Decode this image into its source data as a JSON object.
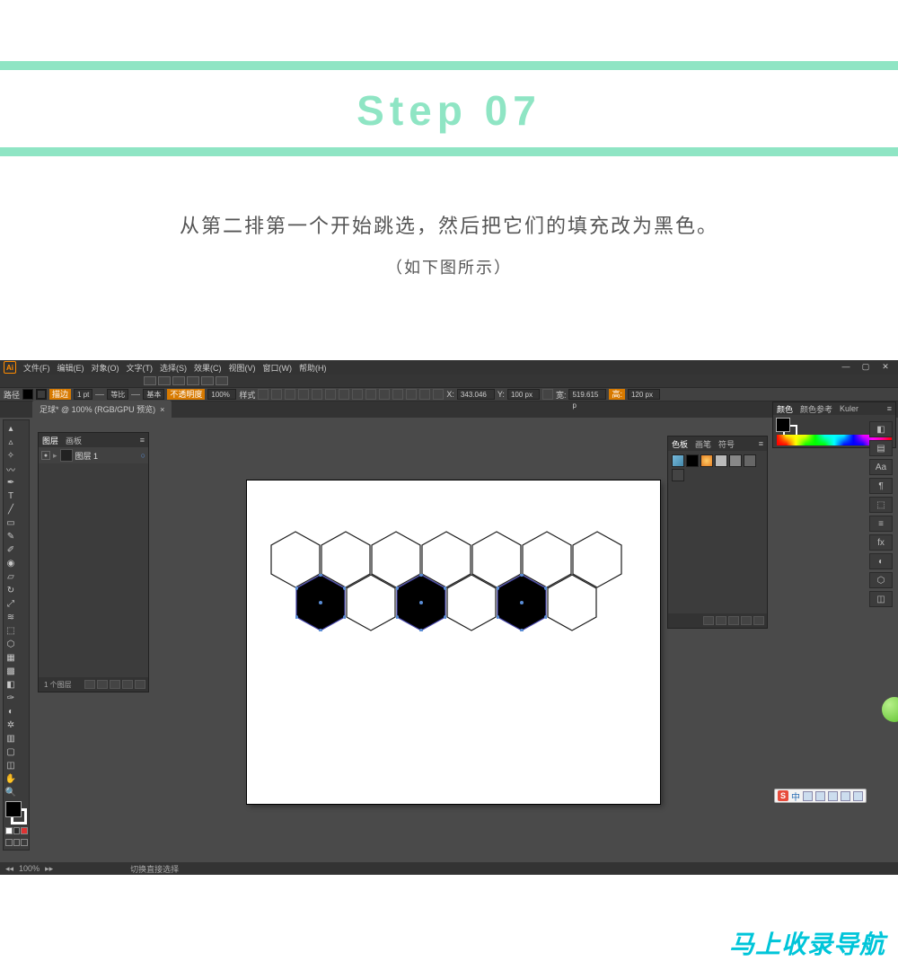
{
  "banner": {
    "step": "Step 07"
  },
  "instruction": {
    "main": "从第二排第一个开始跳选，然后把它们的填充改为黑色。",
    "sub": "（如下图所示）"
  },
  "menu": {
    "items": [
      "文件(F)",
      "编辑(E)",
      "对象(O)",
      "文字(T)",
      "选择(S)",
      "效果(C)",
      "视图(V)",
      "窗口(W)",
      "帮助(H)"
    ]
  },
  "doc": {
    "tab": "足球* @ 100% (RGB/GPU 预览)"
  },
  "control": {
    "path_label": "路径",
    "stroke_label": "描边",
    "stroke_weight": "1 pt",
    "uniform": "等比",
    "basic": "基本",
    "opacity_label": "不透明度",
    "opacity": "100%",
    "style_label": "样式",
    "x_label": "X:",
    "x": "343.046",
    "y_label": "Y:",
    "y": "100 px",
    "w_label": "宽:",
    "w": "519.615 p",
    "h_label": "高:",
    "h": "120 px"
  },
  "layers": {
    "tab1": "图层",
    "tab2": "画板",
    "row": "图层 1",
    "footer": "1 个图层"
  },
  "swatches": {
    "tabs": [
      "色板",
      "画笔",
      "符号"
    ]
  },
  "color": {
    "tabs": [
      "颜色",
      "颜色参考",
      "Kuler"
    ]
  },
  "status": {
    "zoom": "100%",
    "mode": "切换直接选择"
  },
  "ime": {
    "text": "中"
  },
  "watermark": "马上收录导航"
}
